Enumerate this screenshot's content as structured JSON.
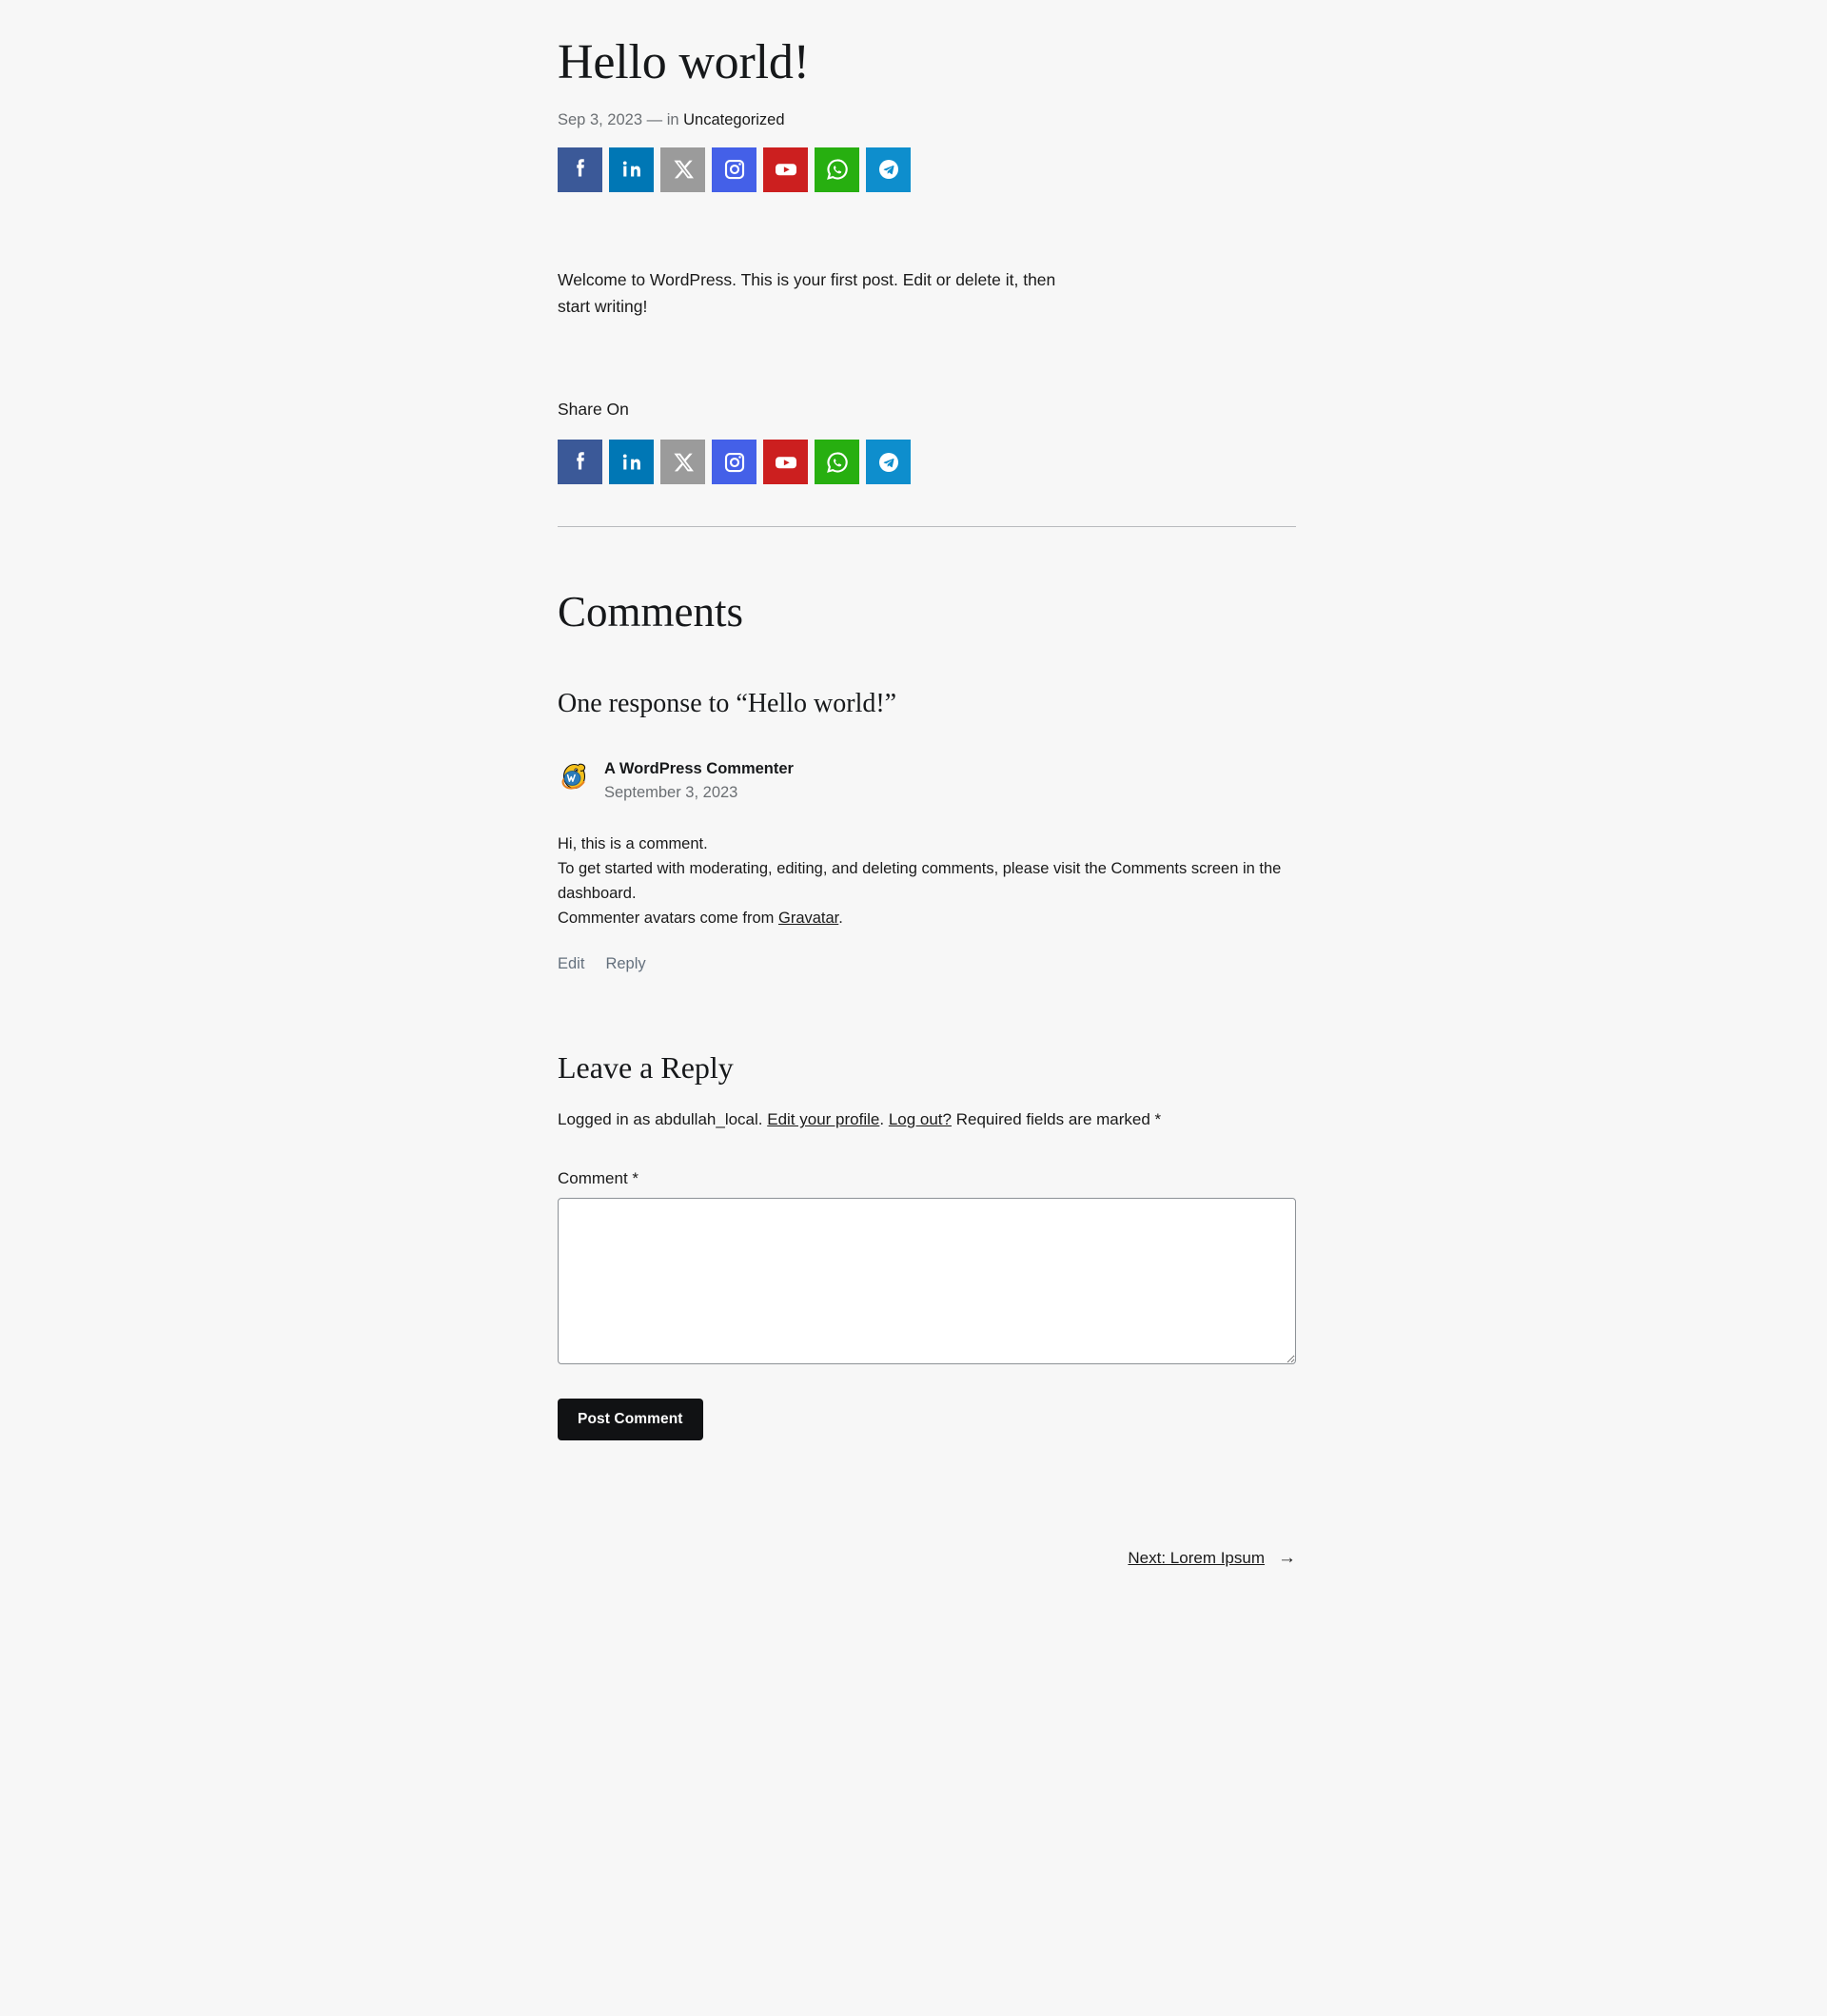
{
  "post": {
    "title": "Hello world!",
    "date": "Sep 3, 2023",
    "separator": "—",
    "in_label": "in",
    "category": "Uncategorized",
    "body": "Welcome to WordPress. This is your first post. Edit or delete it, then start writing!"
  },
  "share": {
    "label": "Share On",
    "networks": [
      {
        "name": "Facebook",
        "icon": "facebook-icon",
        "color": "#3b5998"
      },
      {
        "name": "LinkedIn",
        "icon": "linkedin-icon",
        "color": "#0077b5"
      },
      {
        "name": "X",
        "icon": "x-twitter-icon",
        "color": "#9b9b9b"
      },
      {
        "name": "Instagram",
        "icon": "instagram-icon",
        "color": "#4460e8"
      },
      {
        "name": "YouTube",
        "icon": "youtube-icon",
        "color": "#cc1f1f"
      },
      {
        "name": "WhatsApp",
        "icon": "whatsapp-icon",
        "color": "#27af10"
      },
      {
        "name": "Telegram",
        "icon": "telegram-icon",
        "color": "#0e8ecd"
      }
    ]
  },
  "comments": {
    "heading": "Comments",
    "response_heading": "One response to “Hello world!”",
    "items": [
      {
        "author": "A WordPress Commenter",
        "date": "September 3, 2023",
        "avatar_icon": "wordpress-mystery-man-avatar",
        "body_line_1": "Hi, this is a comment.",
        "body_line_2": "To get started with moderating, editing, and deleting comments, please visit the Comments screen in the dashboard.",
        "body_line_3_prefix": "Commenter avatars come from ",
        "body_line_3_link": "Gravatar",
        "body_line_3_suffix": ".",
        "edit_label": "Edit",
        "reply_label": "Reply"
      }
    ]
  },
  "reply_form": {
    "title": "Leave a Reply",
    "logged_in_prefix": "Logged in as abdullah_local. ",
    "edit_profile_link": "Edit your profile",
    "logged_in_mid": ". ",
    "logout_link": "Log out?",
    "required_note": " Required fields are marked *",
    "comment_label": "Comment *",
    "comment_value": "",
    "comment_placeholder": "",
    "submit_label": "Post Comment"
  },
  "post_nav": {
    "next_label": "Next: Lorem Ipsum",
    "arrow": "→"
  },
  "colors": {
    "page_background": "#f7f7f7",
    "text": "#1a1a1a",
    "muted_text": "#6b6f73",
    "button_background": "#111214",
    "rule": "#b8bbbe"
  }
}
